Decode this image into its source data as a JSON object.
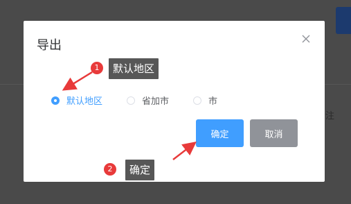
{
  "dialog": {
    "title": "导出",
    "close_icon": "close-icon"
  },
  "region_options": {
    "selected": "默认地区",
    "options": [
      {
        "label": "默认地区",
        "checked": true
      },
      {
        "label": "省加市",
        "checked": false
      },
      {
        "label": "市",
        "checked": false
      }
    ]
  },
  "buttons": {
    "confirm_label": "确定",
    "cancel_label": "取消"
  },
  "annotations": [
    {
      "number": "1",
      "text": "默认地区"
    },
    {
      "number": "2",
      "text": "确定"
    }
  ],
  "background": {
    "partial_text": "注"
  },
  "colors": {
    "accent": "#409eff",
    "cancel": "#909399",
    "badge": "#e83a3a",
    "tag_bg": "#575757",
    "overlay": "#4a4a4a"
  }
}
